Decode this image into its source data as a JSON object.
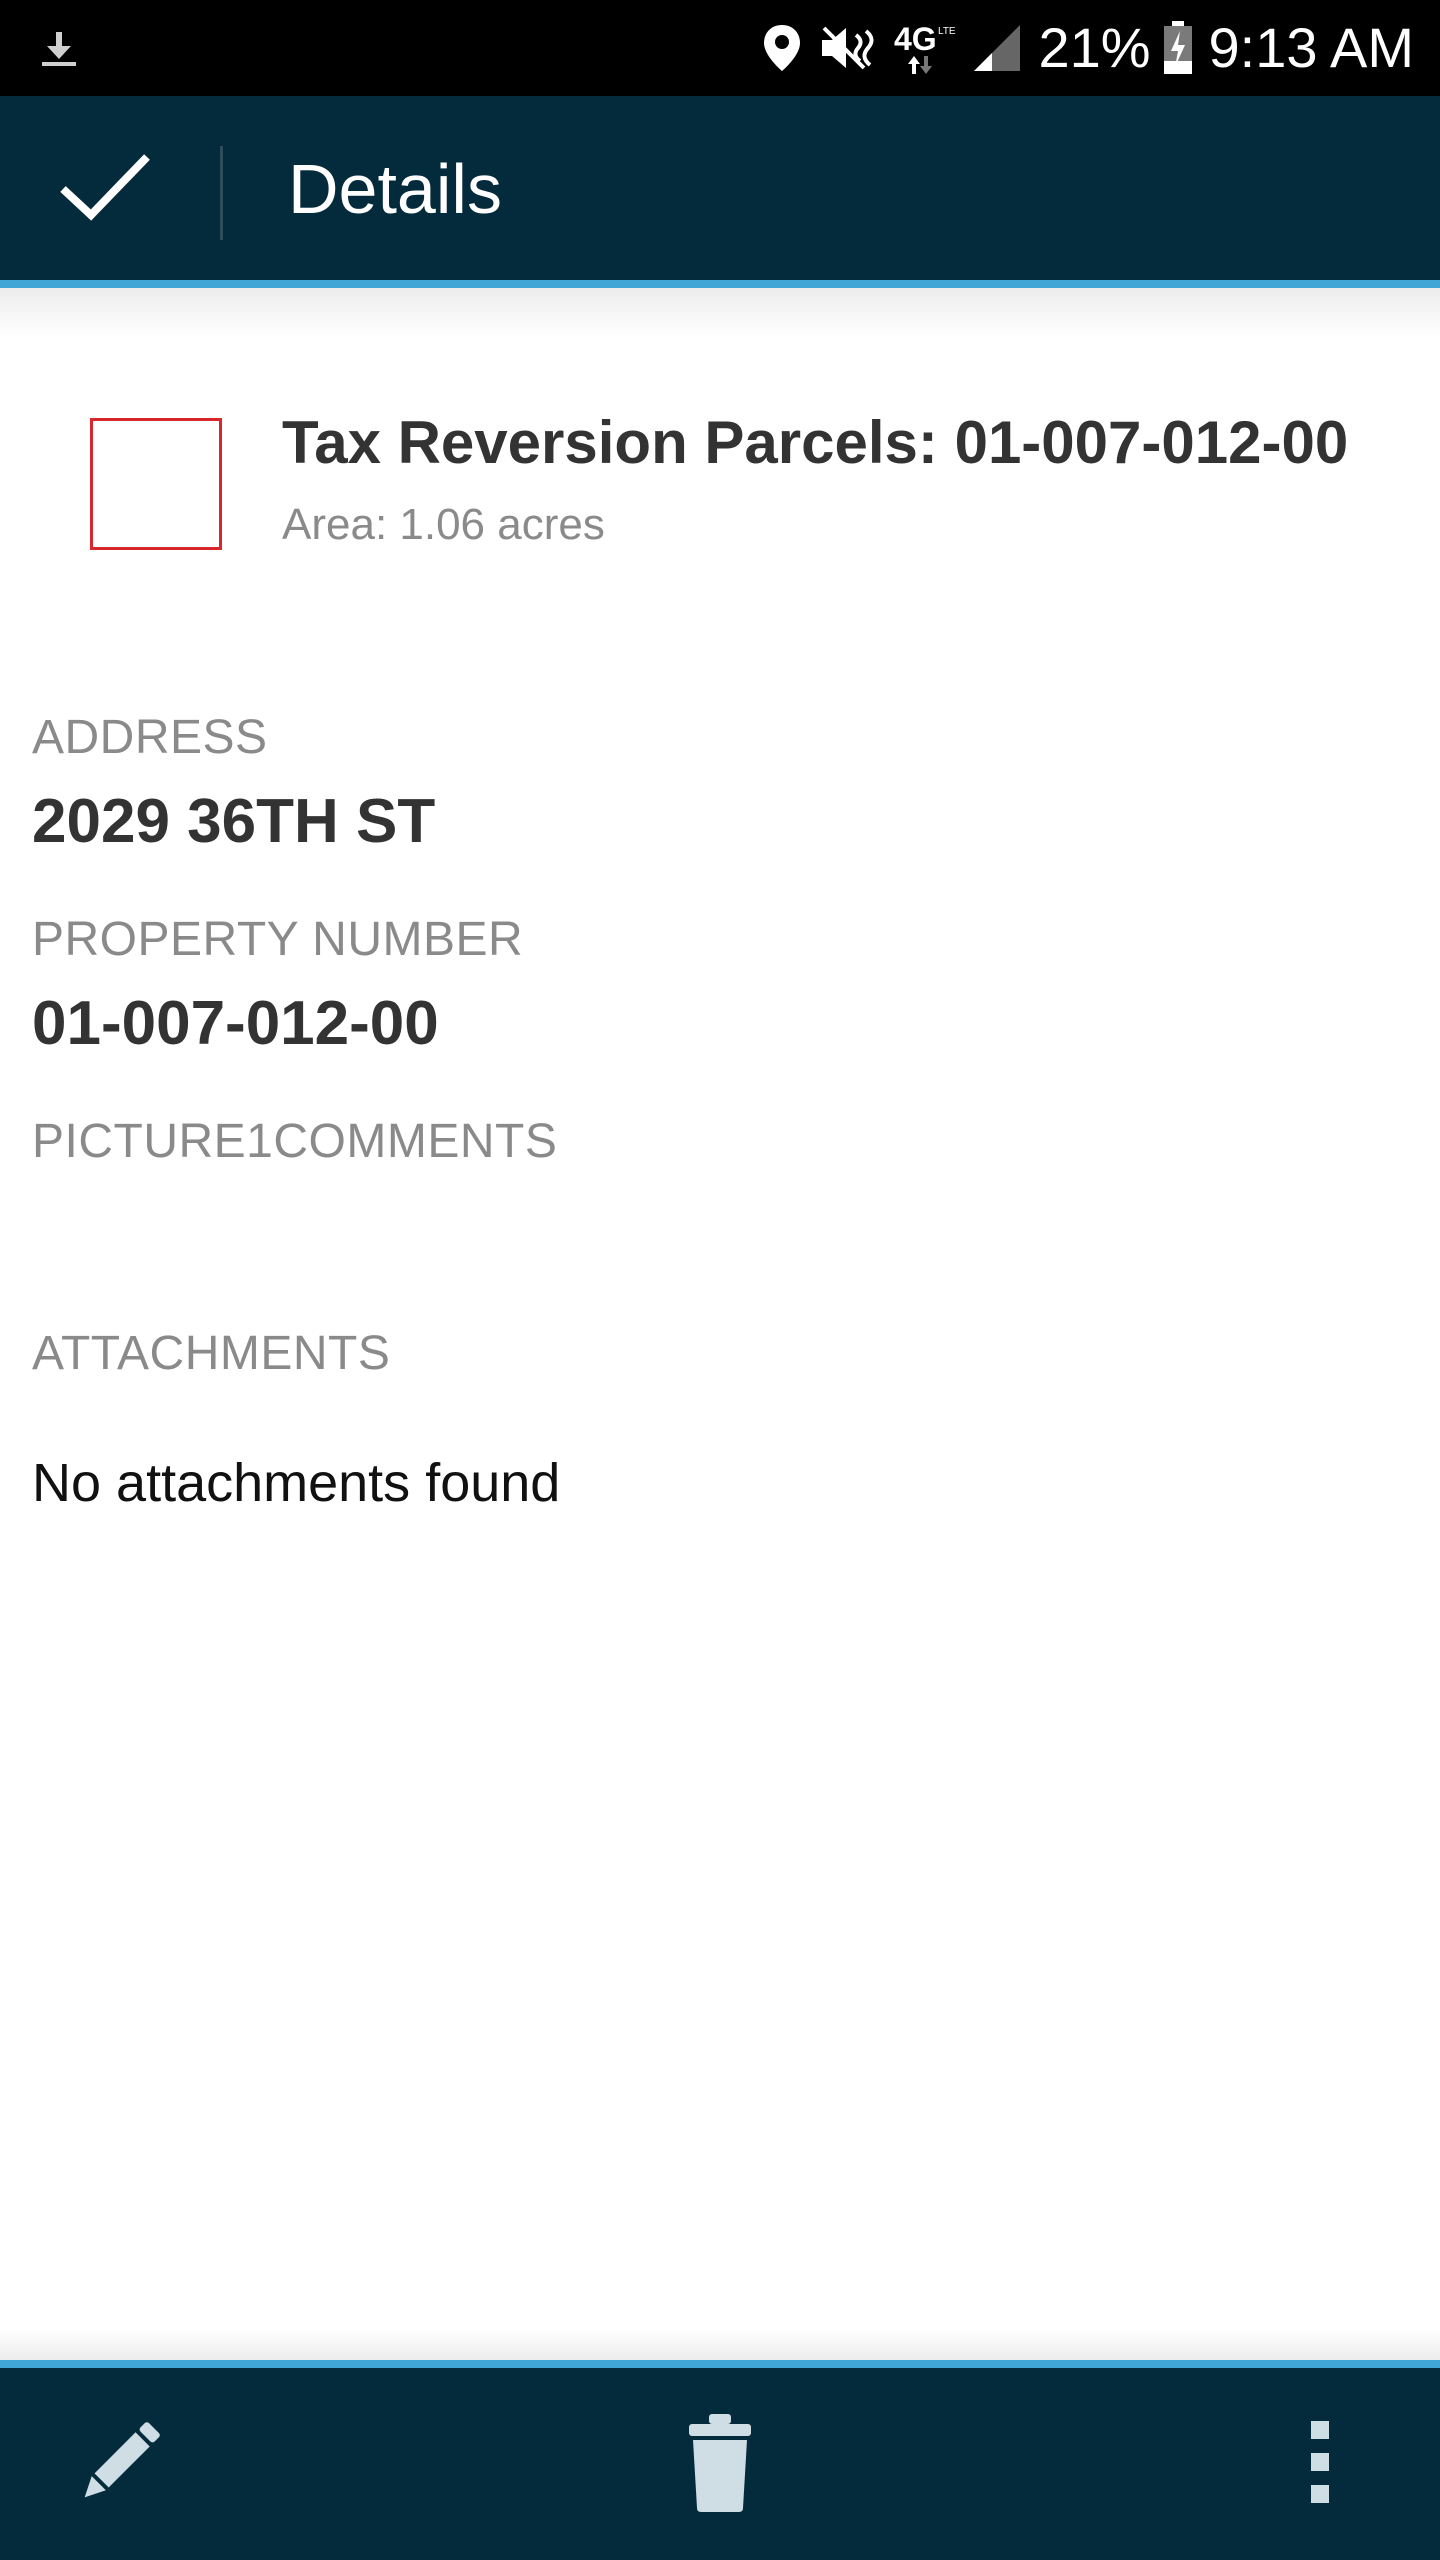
{
  "status_bar": {
    "battery_percent": "21%",
    "time": "9:13 AM",
    "network_label": "4G",
    "icons": [
      "download-icon",
      "location-icon",
      "mute-icon",
      "network-4g-icon",
      "signal-icon",
      "battery-charging-icon"
    ]
  },
  "app_bar": {
    "title": "Details",
    "done_icon": "check-icon"
  },
  "feature": {
    "title": "Tax Reversion Parcels: 01-007-012-00",
    "subtitle": "Area: 1.06 acres",
    "symbol_color": "#d9262c"
  },
  "fields": {
    "address_label": "ADDRESS",
    "address_value": "2029 36TH ST",
    "property_number_label": "PROPERTY NUMBER",
    "property_number_value": "01-007-012-00",
    "picture_comments_label": "PICTURE1COMMENTS",
    "picture_comments_value": ""
  },
  "attachments": {
    "label": "ATTACHMENTS",
    "empty_text": "No attachments found"
  },
  "toolbar": {
    "edit_icon": "pencil-icon",
    "delete_icon": "trash-icon",
    "more_icon": "more-vert-icon"
  },
  "colors": {
    "app_bar": "#042b3c",
    "accent": "#3fa6d6",
    "label_gray": "#8a8a8a",
    "value_text": "#333333"
  }
}
